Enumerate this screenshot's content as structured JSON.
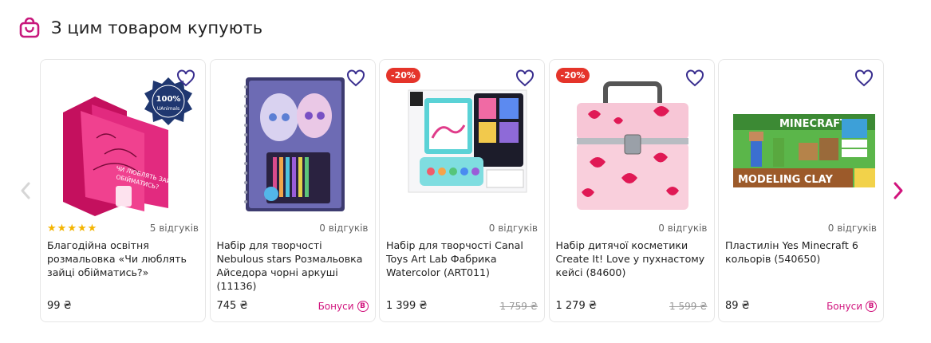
{
  "section": {
    "title": "З цим товаром купують",
    "icon": "shopping-bag-icon",
    "accent": "#c8187c"
  },
  "products": [
    {
      "name": "Благодійна освітня розмальовка «Чи люблять зайці обійматись?»",
      "price": "99 ₴",
      "reviews": "5 відгуків",
      "rating": 5,
      "discount": "",
      "old_price": "",
      "bonus": "",
      "cover_badge_text": "100%",
      "cover_badge_sub": "UAnimals"
    },
    {
      "name": "Набір для творчості Nebulous stars Розмальовка Айседора чорні аркуші (11136)",
      "price": "745 ₴",
      "reviews": "0 відгуків",
      "rating": 0,
      "discount": "",
      "old_price": "",
      "bonus": "Бонуси"
    },
    {
      "name": "Набір для творчості Canal Toys Art Lab Фабрика Watercolor (ART011)",
      "price": "1 399 ₴",
      "reviews": "0 відгуків",
      "rating": 0,
      "discount": "-20%",
      "old_price": "1 759 ₴",
      "bonus": ""
    },
    {
      "name": "Набір дитячої косметики Create It! Love у пухнастому кейсі (84600)",
      "price": "1 279 ₴",
      "reviews": "0 відгуків",
      "rating": 0,
      "discount": "-20%",
      "old_price": "1 599 ₴",
      "bonus": ""
    },
    {
      "name": "Пластилін Yes Minecraft 6 кольорів (540650)",
      "price": "89 ₴",
      "reviews": "0 відгуків",
      "rating": 0,
      "discount": "",
      "old_price": "",
      "bonus": "Бонуси",
      "box_title": "MINECRAFT",
      "box_subtitle": "MODELING CLAY"
    }
  ],
  "bonus_symbol": "B",
  "star_glyph": "★"
}
